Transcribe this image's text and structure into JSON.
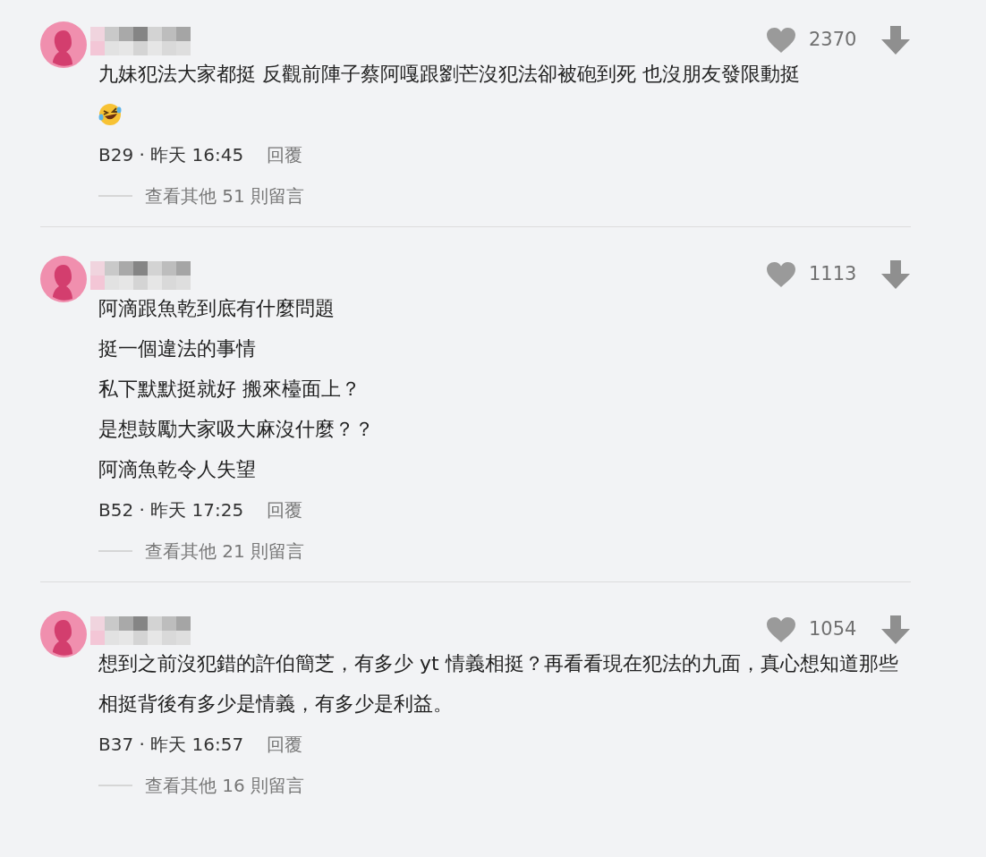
{
  "comments": [
    {
      "likes": "2370",
      "body": [
        {
          "kind": "text",
          "text": "九妹犯法大家都挺 反觀前陣子蔡阿嘎跟劉芒沒犯法卻被砲到死 也沒朋友發限動挺"
        },
        {
          "kind": "emoji"
        }
      ],
      "meta": "B29 · 昨天 16:45",
      "reply": "回覆",
      "more": "查看其他 51 則留言"
    },
    {
      "likes": "1113",
      "body": [
        {
          "kind": "text",
          "text": "阿滴跟魚乾到底有什麼問題"
        },
        {
          "kind": "text",
          "text": "挺一個違法的事情"
        },
        {
          "kind": "text",
          "text": "私下默默挺就好 搬來檯面上？"
        },
        {
          "kind": "text",
          "text": "是想鼓勵大家吸大麻沒什麼？？"
        },
        {
          "kind": "text",
          "text": "阿滴魚乾令人失望"
        }
      ],
      "meta": "B52 · 昨天 17:25",
      "reply": "回覆",
      "more": "查看其他 21 則留言"
    },
    {
      "likes": "1054",
      "body": [
        {
          "kind": "text",
          "text": "想到之前沒犯錯的許伯簡芝，有多少 yt 情義相挺？再看看現在犯法的九面，真心想知道那些相挺背後有多少是情義，有多少是利益。"
        }
      ],
      "meta": "B37 · 昨天 16:57",
      "reply": "回覆",
      "more": "查看其他 16 則留言"
    }
  ]
}
